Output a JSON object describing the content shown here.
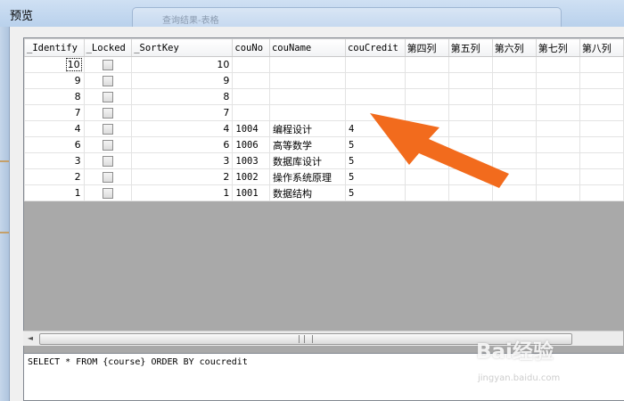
{
  "window": {
    "title": "预览",
    "background_window_label": "查询结果-表格"
  },
  "grid": {
    "columns": [
      "_Identify",
      "_Locked",
      "_SortKey",
      "couNo",
      "couName",
      "couCredit",
      "第四列",
      "第五列",
      "第六列",
      "第七列",
      "第八列"
    ],
    "rows": [
      {
        "identify": "10",
        "locked": false,
        "sortkey": "10",
        "couNo": "",
        "couName": "",
        "couCredit": ""
      },
      {
        "identify": "9",
        "locked": false,
        "sortkey": "9",
        "couNo": "",
        "couName": "",
        "couCredit": ""
      },
      {
        "identify": "8",
        "locked": false,
        "sortkey": "8",
        "couNo": "",
        "couName": "",
        "couCredit": ""
      },
      {
        "identify": "7",
        "locked": false,
        "sortkey": "7",
        "couNo": "",
        "couName": "",
        "couCredit": ""
      },
      {
        "identify": "4",
        "locked": false,
        "sortkey": "4",
        "couNo": "1004",
        "couName": "编程设计",
        "couCredit": "4"
      },
      {
        "identify": "6",
        "locked": false,
        "sortkey": "6",
        "couNo": "1006",
        "couName": "高等数学",
        "couCredit": "5"
      },
      {
        "identify": "3",
        "locked": false,
        "sortkey": "3",
        "couNo": "1003",
        "couName": "数据库设计",
        "couCredit": "5"
      },
      {
        "identify": "2",
        "locked": false,
        "sortkey": "2",
        "couNo": "1002",
        "couName": "操作系统原理",
        "couCredit": "5"
      },
      {
        "identify": "1",
        "locked": false,
        "sortkey": "1",
        "couNo": "1001",
        "couName": "数据结构",
        "couCredit": "5"
      }
    ]
  },
  "scrollbar": {
    "left_arrow": "◄",
    "thumb_fraction": 0.91
  },
  "sql": {
    "query": "SELECT * FROM {course} ORDER BY coucredit"
  },
  "watermark": {
    "logo": "Bai经验",
    "site": "jingyan.baidu.com"
  },
  "annotation": {
    "arrow_color": "#f26b1d"
  },
  "colors": {
    "grid_background": "#ffffff",
    "empty_area": "#a9a9a9",
    "title_bar": "#c3d7ef"
  }
}
